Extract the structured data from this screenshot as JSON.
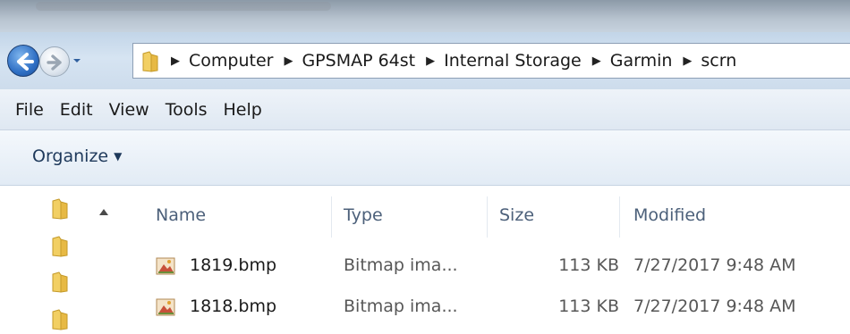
{
  "window": {
    "title_bar": ""
  },
  "nav": {
    "back_icon": "back-arrow-icon",
    "forward_icon": "forward-arrow-icon",
    "recent_icon": "chevron-down-icon",
    "breadcrumbs": [
      "Computer",
      "GPSMAP 64st",
      "Internal Storage",
      "Garmin",
      "scrn"
    ]
  },
  "menu": {
    "items": [
      "File",
      "Edit",
      "View",
      "Tools",
      "Help"
    ]
  },
  "toolbar": {
    "organize_label": "Organize",
    "organize_icon": "chevron-down-icon"
  },
  "columns": {
    "name": "Name",
    "type": "Type",
    "size": "Size",
    "modified": "Modified"
  },
  "files": [
    {
      "name": "1819.bmp",
      "type": "Bitmap ima...",
      "size": "113 KB",
      "modified": "7/27/2017 9:48 AM"
    },
    {
      "name": "1818.bmp",
      "type": "Bitmap ima...",
      "size": "113 KB",
      "modified": "7/27/2017 9:48 AM"
    }
  ],
  "colors": {
    "accent": "#2f6fc4",
    "folder": "#f0c850",
    "header_text": "#4c607a"
  }
}
